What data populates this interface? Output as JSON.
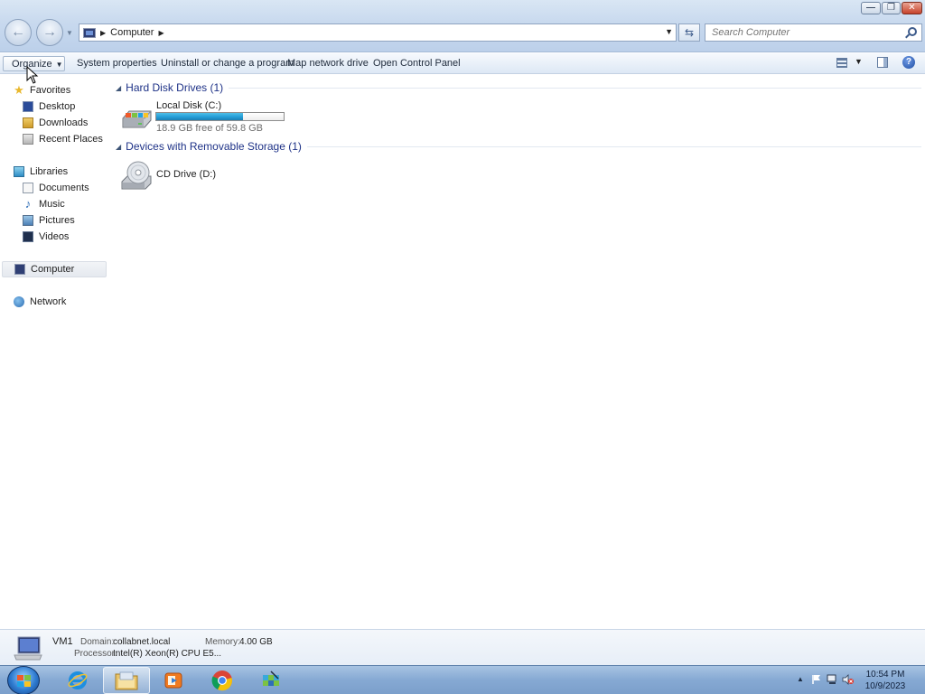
{
  "window": {
    "minimize_glyph": "—",
    "maximize_glyph": "❐",
    "close_glyph": "✕"
  },
  "nav": {
    "back_glyph": "←",
    "forward_glyph": "→",
    "history_glyph": "▼"
  },
  "address": {
    "crumbs": [
      "Computer"
    ],
    "separator_glyph": "▶",
    "dropdown_glyph": "▼"
  },
  "refresh_glyph": "⇆",
  "search": {
    "placeholder": "Search Computer"
  },
  "commandbar": {
    "organize": "Organize",
    "caret": "▼",
    "system_properties": "System properties",
    "uninstall": "Uninstall or change a program",
    "map_drive": "Map network drive",
    "control_panel": "Open Control Panel",
    "help_glyph": "?"
  },
  "navpane": {
    "favorites": "Favorites",
    "desktop": "Desktop",
    "downloads": "Downloads",
    "recent_places": "Recent Places",
    "libraries": "Libraries",
    "documents": "Documents",
    "music": "Music",
    "pictures": "Pictures",
    "videos": "Videos",
    "computer": "Computer",
    "network": "Network",
    "star_glyph": "★",
    "note_glyph": "♪"
  },
  "groups": {
    "hdd": {
      "label": "Hard Disk Drives (1)",
      "collapse_glyph": "◢"
    },
    "removable": {
      "label": "Devices with Removable Storage (1)",
      "collapse_glyph": "◢"
    }
  },
  "drives": {
    "c": {
      "name": "Local Disk (C:)",
      "free_text": "18.9 GB free of 59.8 GB",
      "used_fraction": 0.684
    },
    "d": {
      "name": "CD Drive (D:)"
    }
  },
  "details": {
    "name": "VM1",
    "domain_label": "Domain:",
    "domain_value": "collabnet.local",
    "memory_label": "Memory:",
    "memory_value": "4.00 GB",
    "processor_label": "Processor:",
    "processor_value": "Intel(R) Xeon(R) CPU E5..."
  },
  "taskbar": {
    "tray_show_hidden": "▲",
    "time": "10:54 PM",
    "date": "10/9/2023"
  },
  "colors": {
    "usage_fill": "#26a0da",
    "group_header": "#1e3287",
    "taskbar": "#86a9d3"
  }
}
